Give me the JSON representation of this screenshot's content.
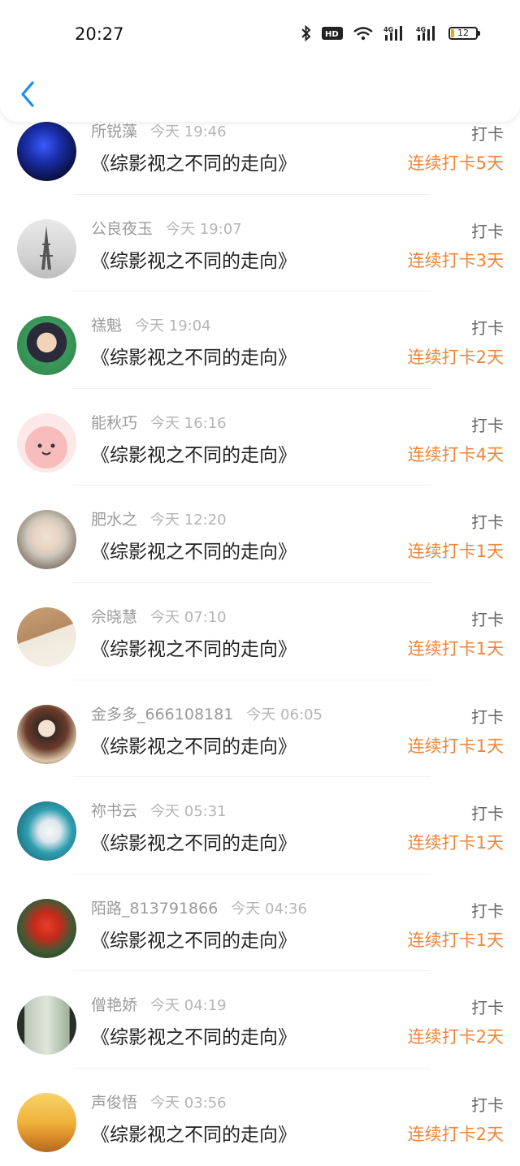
{
  "status_bar": {
    "time": "20:27",
    "battery": "12"
  },
  "colors": {
    "accent": "#1a8cf0",
    "streak": "#f0853a",
    "meta": "#9a9a9a"
  },
  "items": [
    {
      "name": "所锐藻",
      "time": "今天 19:46",
      "title": "《综影视之不同的走向》",
      "action": "打卡",
      "streak": "连续打卡5天"
    },
    {
      "name": "公良夜玉",
      "time": "今天 19:07",
      "title": "《综影视之不同的走向》",
      "action": "打卡",
      "streak": "连续打卡3天"
    },
    {
      "name": "禚魁",
      "time": "今天 19:04",
      "title": "《综影视之不同的走向》",
      "action": "打卡",
      "streak": "连续打卡2天"
    },
    {
      "name": "能秋巧",
      "time": "今天 16:16",
      "title": "《综影视之不同的走向》",
      "action": "打卡",
      "streak": "连续打卡4天"
    },
    {
      "name": "肥水之",
      "time": "今天 12:20",
      "title": "《综影视之不同的走向》",
      "action": "打卡",
      "streak": "连续打卡1天"
    },
    {
      "name": "佘晓慧",
      "time": "今天 07:10",
      "title": "《综影视之不同的走向》",
      "action": "打卡",
      "streak": "连续打卡1天"
    },
    {
      "name": "金多多_666108181",
      "time": "今天 06:05",
      "title": "《综影视之不同的走向》",
      "action": "打卡",
      "streak": "连续打卡1天"
    },
    {
      "name": "祢书云",
      "time": "今天 05:31",
      "title": "《综影视之不同的走向》",
      "action": "打卡",
      "streak": "连续打卡1天"
    },
    {
      "name": "陌路_813791866",
      "time": "今天 04:36",
      "title": "《综影视之不同的走向》",
      "action": "打卡",
      "streak": "连续打卡1天"
    },
    {
      "name": "僧艳娇",
      "time": "今天 04:19",
      "title": "《综影视之不同的走向》",
      "action": "打卡",
      "streak": "连续打卡2天"
    },
    {
      "name": "声俊悟",
      "time": "今天 03:56",
      "title": "《综影视之不同的走向》",
      "action": "打卡",
      "streak": "连续打卡2天"
    }
  ]
}
